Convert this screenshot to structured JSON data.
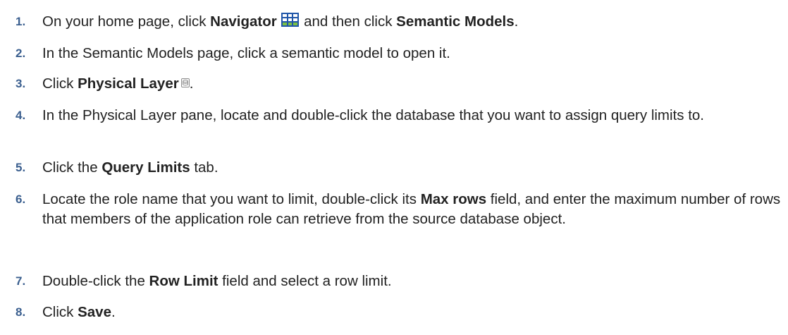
{
  "steps": [
    {
      "number": "1.",
      "pre": "On your home page, click ",
      "bold1": "Navigator",
      "icon": "navigator-grid-icon",
      "mid": " and then click ",
      "bold2": "Semantic Models",
      "post": "."
    },
    {
      "number": "2.",
      "text": "In the Semantic Models page, click a semantic model to open it."
    },
    {
      "number": "3.",
      "pre": "Click ",
      "bold": "Physical Layer",
      "icon": "physical-layer-database-icon",
      "post": "."
    },
    {
      "number": "4.",
      "text": "In the Physical Layer pane, locate and double-click the database that you want to assign query limits to."
    },
    {
      "number": "5.",
      "pre": "Click the ",
      "bold": "Query Limits",
      "post": " tab."
    },
    {
      "number": "6.",
      "pre": "Locate the role name that you want to limit, double-click its ",
      "bold": "Max rows",
      "post": " field, and enter the maximum number of rows that members of the application role can retrieve from the source database object."
    },
    {
      "number": "7.",
      "pre": "Double-click the ",
      "bold": "Row Limit",
      "post": " field and select a row limit."
    },
    {
      "number": "8.",
      "pre": "Click ",
      "bold": "Save",
      "post": "."
    }
  ],
  "colors": {
    "step_number": "#3b5f8f",
    "body_text": "#222222",
    "icon_blue": "#1f56a8",
    "icon_green": "#4a9a2a"
  }
}
